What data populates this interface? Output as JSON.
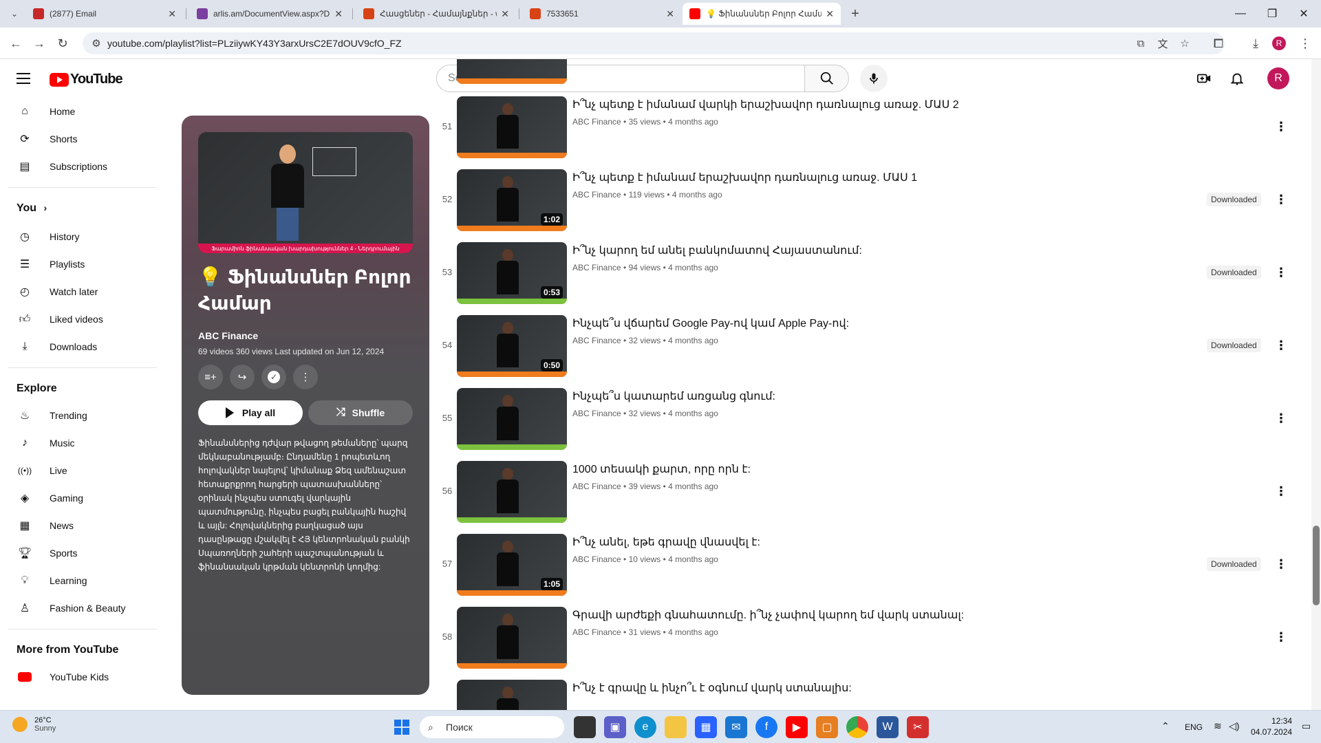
{
  "browser": {
    "tabs": [
      {
        "title": "(2877) Email",
        "icon": "mail-icon",
        "color": "#c62828"
      },
      {
        "title": "arlis.am/DocumentView.aspx?D",
        "icon": "arlis-icon",
        "color": "#7b3fa0"
      },
      {
        "title": "Հասցեներ - Համայնքներ - w",
        "icon": "wiki-icon",
        "color": "#d84315"
      },
      {
        "title": "7533651",
        "icon": "wiki-icon",
        "color": "#d84315"
      },
      {
        "title": "💡 Ֆինանսներ Բոլոր Համա",
        "icon": "youtube-icon",
        "color": "#ff0000"
      }
    ],
    "url": "youtube.com/playlist?list=PLziiywKY43Y3arxUrsC2E7dOUV9cfO_FZ",
    "profile_initial": "R"
  },
  "youtube": {
    "logo_text": "YouTube",
    "search_placeholder": "Search",
    "avatar_initial": "R",
    "sidebar": {
      "main": [
        {
          "label": "Home",
          "icon": "home-icon"
        },
        {
          "label": "Shorts",
          "icon": "shorts-icon"
        },
        {
          "label": "Subscriptions",
          "icon": "subscriptions-icon"
        }
      ],
      "you_heading": "You",
      "you": [
        {
          "label": "History",
          "icon": "history-icon"
        },
        {
          "label": "Playlists",
          "icon": "playlists-icon"
        },
        {
          "label": "Watch later",
          "icon": "watch-later-icon"
        },
        {
          "label": "Liked videos",
          "icon": "like-icon"
        },
        {
          "label": "Downloads",
          "icon": "download-icon"
        }
      ],
      "explore_heading": "Explore",
      "explore": [
        {
          "label": "Trending",
          "icon": "trending-icon"
        },
        {
          "label": "Music",
          "icon": "music-icon"
        },
        {
          "label": "Live",
          "icon": "live-icon"
        },
        {
          "label": "Gaming",
          "icon": "gaming-icon"
        },
        {
          "label": "News",
          "icon": "news-icon"
        },
        {
          "label": "Sports",
          "icon": "sports-icon"
        },
        {
          "label": "Learning",
          "icon": "learning-icon"
        },
        {
          "label": "Fashion & Beauty",
          "icon": "fashion-icon"
        }
      ],
      "more_heading": "More from YouTube",
      "more": [
        {
          "label": "YouTube Kids",
          "icon": "youtube-kids-icon"
        }
      ]
    },
    "playlist": {
      "title": "💡 Ֆինանսներ Բոլոր Համար",
      "owner": "ABC Finance",
      "meta": "69 videos   360 views   Last updated on Jun 12, 2024",
      "thumb_caption": "Ֆարամիոն ֆինանսական խարդախություններ 4 - Ներդրումային",
      "play_all": "Play all",
      "shuffle": "Shuffle",
      "description": "Ֆինանսներից դժվար թվացող թեմաները՝ պարզ մեկնաբանությամբ։ Ընդամենը 1 րոպետևող հոլովակներ նայելով՝ կիմանաք Ձեզ ամենաշատ հետաքրքրող հարցերի պատասխանները՝ օրինակ ինչպես ստուգել վարկային պատմությունը, ինչպես բացել բանկային հաշիվ և այլն: Հոլովակներից բաղկացած այս դասընթացը մշակվել է ՀՅ կենտրոնական բանկի Սպառողների շահերի պաշտպանության և ֆինանսական կրթման կենտրոնի կողմից:"
    },
    "videos": [
      {
        "num": "51",
        "title": "Ի՞նչ պետք է իմանամ վարկի երաշխավոր դառնալուց առաջ. ՄԱՍ 2",
        "meta": "ABC Finance • 35 views • 4 months ago",
        "duration": "",
        "downloaded": "",
        "bar_color": "#f07c1e"
      },
      {
        "num": "52",
        "title": "Ի՞նչ պետք է իմանամ երաշխավոր դառնալուց առաջ. ՄԱՍ 1",
        "meta": "ABC Finance • 119 views • 4 months ago",
        "duration": "1:02",
        "downloaded": "Downloaded",
        "bar_color": "#f07c1e"
      },
      {
        "num": "53",
        "title": "Ի՞նչ կարող եմ անել բանկոմատով Հայաստանում:",
        "meta": "ABC Finance • 94 views • 4 months ago",
        "duration": "0:53",
        "downloaded": "Downloaded",
        "bar_color": "#7cc23e"
      },
      {
        "num": "54",
        "title": "Ինչպե՞ս վճարեմ Google Pay-ով կամ Apple Pay-ով:",
        "meta": "ABC Finance • 32 views • 4 months ago",
        "duration": "0:50",
        "downloaded": "Downloaded",
        "bar_color": "#f07c1e"
      },
      {
        "num": "55",
        "title": "Ինչպե՞ս կատարեմ առցանց գնում:",
        "meta": "ABC Finance • 32 views • 4 months ago",
        "duration": "",
        "downloaded": "",
        "bar_color": "#7cc23e"
      },
      {
        "num": "56",
        "title": "1000 տեսակի քարտ, որը որն է:",
        "meta": "ABC Finance • 39 views • 4 months ago",
        "duration": "",
        "downloaded": "",
        "bar_color": "#7cc23e"
      },
      {
        "num": "57",
        "title": "Ի՞նչ անել, եթե գրավը վնասվել է:",
        "meta": "ABC Finance • 10 views • 4 months ago",
        "duration": "1:05",
        "downloaded": "Downloaded",
        "bar_color": "#f07c1e"
      },
      {
        "num": "58",
        "title": "Գրավի արժեքի գնահատումը. ի՞նչ չափով կարող եմ վարկ ստանալ:",
        "meta": "ABC Finance • 31 views • 4 months ago",
        "duration": "",
        "downloaded": "",
        "bar_color": "#f07c1e"
      },
      {
        "num": "",
        "title": "Ի՞նչ է գրավը և ինչո՞ւ է օգնում վարկ ստանալիս:",
        "meta": "",
        "duration": "",
        "downloaded": "",
        "bar_color": "#7cc23e"
      }
    ]
  },
  "taskbar": {
    "weather_temp": "26°C",
    "weather_desc": "Sunny",
    "search_placeholder": "Поиск",
    "lang": "ENG",
    "time": "12:34",
    "date": "04.07.2024"
  }
}
